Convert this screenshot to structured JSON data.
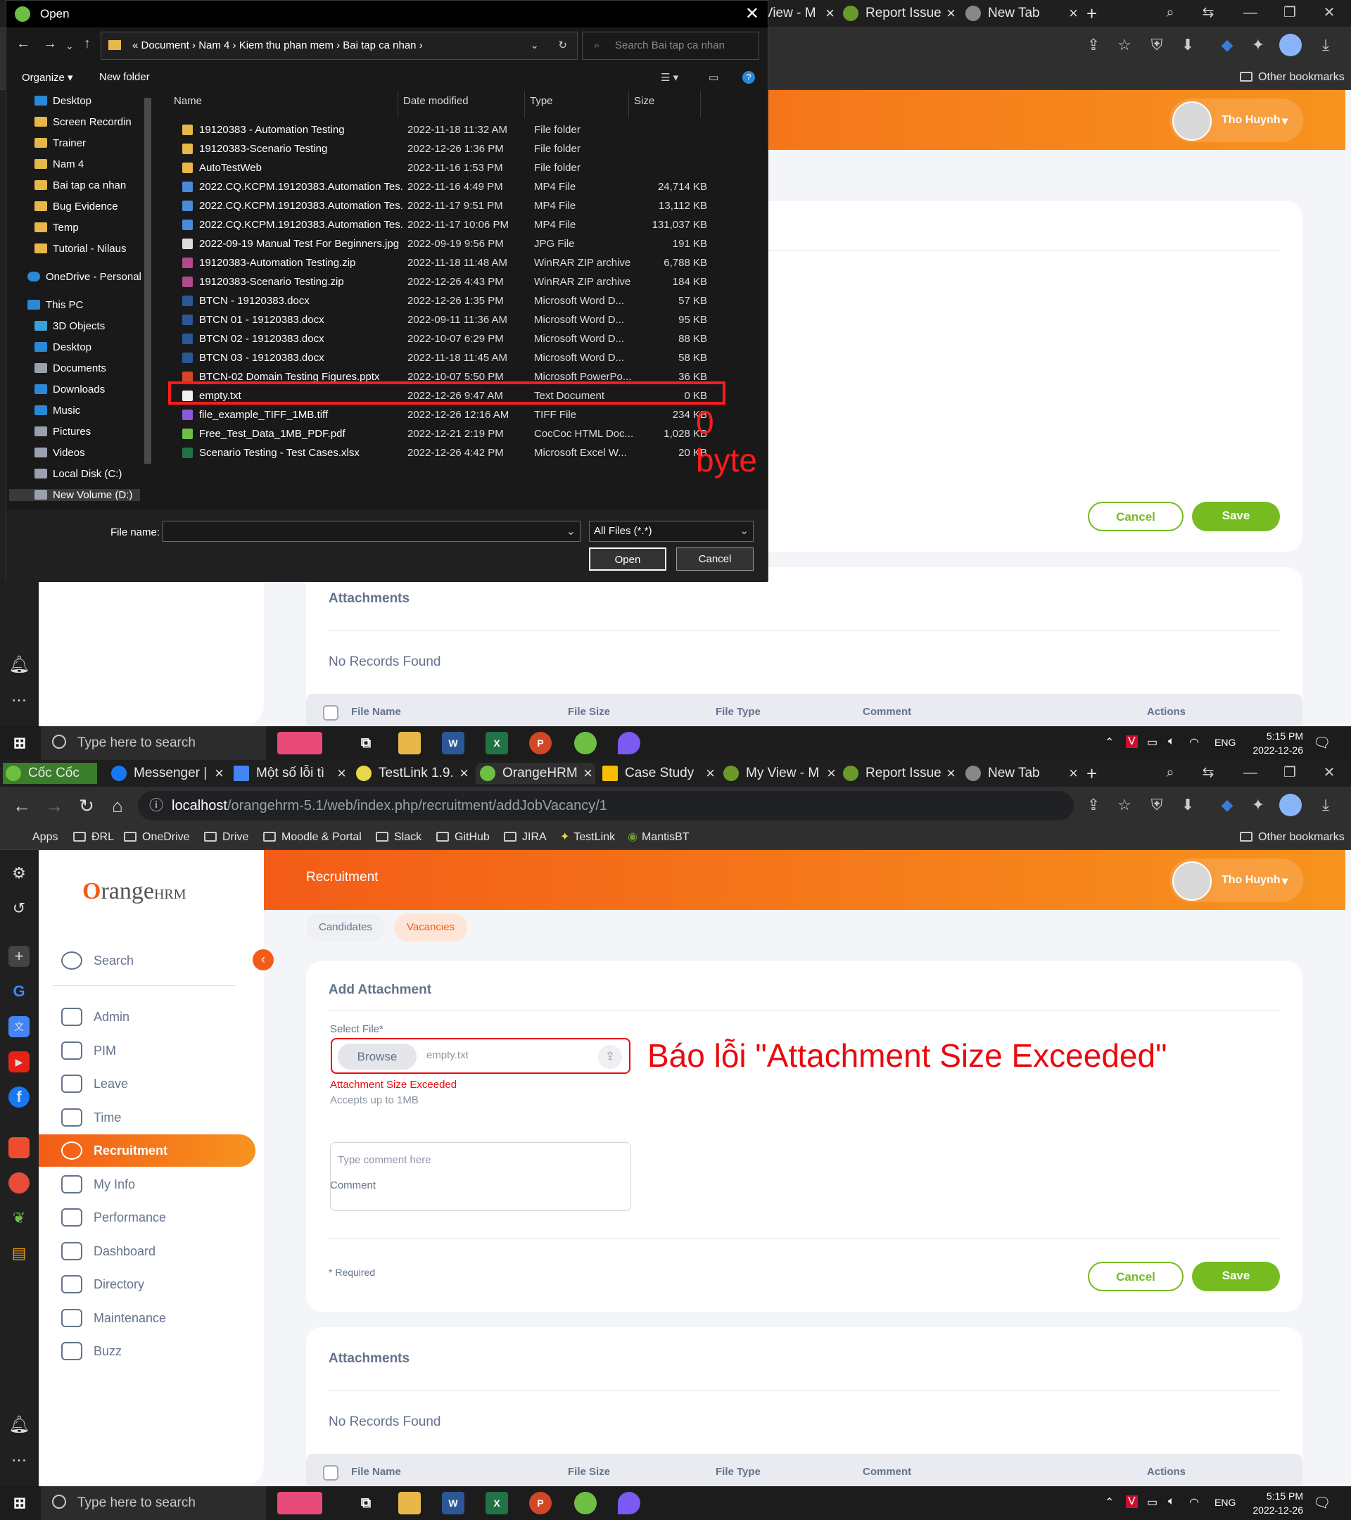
{
  "colors": {
    "orange": "#f35c17",
    "green": "#76bc21",
    "error": "#eb0910",
    "annotation_red": "#ff1b1b"
  },
  "browser": {
    "tabs": [
      {
        "label": "Cốc Cốc",
        "icon": "coccoc-icon"
      },
      {
        "label": "Messenger |",
        "icon": "facebook-icon"
      },
      {
        "label": "Một số lỗi tì",
        "icon": "docs-icon"
      },
      {
        "label": "TestLink 1.9.",
        "icon": "testlink-icon"
      },
      {
        "label": "OrangeHRM",
        "icon": "coccoc-icon"
      },
      {
        "label": "Case Study",
        "icon": "drive-icon"
      },
      {
        "label": "My View - M",
        "icon": "mantis-icon"
      },
      {
        "label": "Report Issue",
        "icon": "mantis-icon"
      },
      {
        "label": "New Tab",
        "icon": "coccoc-icon"
      }
    ],
    "top_tabs_visible": [
      {
        "label": "View - M"
      },
      {
        "label": "Report Issue"
      },
      {
        "label": "New Tab"
      }
    ],
    "url_host": "localhost",
    "url_path": "/orangehrm-5.1/web/index.php/recruitment/addJobVacancy/1",
    "bookmarks": [
      "Apps",
      "ĐRL",
      "OneDrive",
      "Drive",
      "Moodle & Portal",
      "Slack",
      "GitHub",
      "JIRA",
      "TestLink",
      "MantisBT"
    ],
    "other_bookmarks": "Other bookmarks"
  },
  "dialog": {
    "title": "Open",
    "breadcrumb": "«  Document  ›  Nam 4  ›  Kiem thu phan mem  ›  Bai tap ca nhan  ›",
    "search_placeholder": "Search Bai tap ca nhan",
    "organize": "Organize ▾",
    "new_folder": "New folder",
    "nav_tree": [
      {
        "label": "Desktop",
        "color": "#2b88d8"
      },
      {
        "label": "Screen Recordin",
        "color": "#e8b74a"
      },
      {
        "label": "Trainer",
        "color": "#e8b74a"
      },
      {
        "label": "Nam 4",
        "color": "#e8b74a"
      },
      {
        "label": "Bai tap ca nhan",
        "color": "#e8b74a"
      },
      {
        "label": "Bug Evidence",
        "color": "#e8b74a"
      },
      {
        "label": "Temp",
        "color": "#e8b74a"
      },
      {
        "label": "Tutorial - Nilaus",
        "color": "#e8b74a"
      },
      {
        "label": "OneDrive - Personal",
        "color": "#2b88d8"
      },
      {
        "label": "This PC",
        "color": "#2b88d8"
      },
      {
        "label": "3D Objects",
        "color": "#3aa0d8"
      },
      {
        "label": "Desktop",
        "color": "#2b88d8"
      },
      {
        "label": "Documents",
        "color": "#9aa0b0"
      },
      {
        "label": "Downloads",
        "color": "#2b88d8"
      },
      {
        "label": "Music",
        "color": "#2b88d8"
      },
      {
        "label": "Pictures",
        "color": "#9aa0b0"
      },
      {
        "label": "Videos",
        "color": "#9aa0b0"
      },
      {
        "label": "Local Disk (C:)",
        "color": "#9aa0b0"
      },
      {
        "label": "New Volume (D:)",
        "color": "#9aa0b0"
      }
    ],
    "columns": [
      "Name",
      "Date modified",
      "Type",
      "Size"
    ],
    "files": [
      {
        "name": "19120383 - Automation Testing",
        "date": "2022-11-18 11:32 AM",
        "type": "File folder",
        "size": "",
        "color": "#e8b74a"
      },
      {
        "name": "19120383-Scenario Testing",
        "date": "2022-12-26 1:36 PM",
        "type": "File folder",
        "size": "",
        "color": "#e8b74a"
      },
      {
        "name": "AutoTestWeb",
        "date": "2022-11-16 1:53 PM",
        "type": "File folder",
        "size": "",
        "color": "#e8b74a"
      },
      {
        "name": "2022.CQ.KCPM.19120383.Automation Tes...",
        "date": "2022-11-16 4:49 PM",
        "type": "MP4 File",
        "size": "24,714 KB",
        "color": "#4a8ad8"
      },
      {
        "name": "2022.CQ.KCPM.19120383.Automation Tes...",
        "date": "2022-11-17 9:51 PM",
        "type": "MP4 File",
        "size": "13,112 KB",
        "color": "#4a8ad8"
      },
      {
        "name": "2022.CQ.KCPM.19120383.Automation Tes...",
        "date": "2022-11-17 10:06 PM",
        "type": "MP4 File",
        "size": "131,037 KB",
        "color": "#4a8ad8"
      },
      {
        "name": "2022-09-19 Manual Test For Beginners.jpg",
        "date": "2022-09-19 9:56 PM",
        "type": "JPG File",
        "size": "191 KB",
        "color": "#dcdcdc"
      },
      {
        "name": "19120383-Automation Testing.zip",
        "date": "2022-11-18 11:48 AM",
        "type": "WinRAR ZIP archive",
        "size": "6,788 KB",
        "color": "#b04a8a"
      },
      {
        "name": "19120383-Scenario Testing.zip",
        "date": "2022-12-26 4:43 PM",
        "type": "WinRAR ZIP archive",
        "size": "184 KB",
        "color": "#b04a8a"
      },
      {
        "name": "BTCN - 19120383.docx",
        "date": "2022-12-26 1:35 PM",
        "type": "Microsoft Word D...",
        "size": "57 KB",
        "color": "#2b5797"
      },
      {
        "name": "BTCN 01 - 19120383.docx",
        "date": "2022-09-11 11:36 AM",
        "type": "Microsoft Word D...",
        "size": "95 KB",
        "color": "#2b5797"
      },
      {
        "name": "BTCN 02 - 19120383.docx",
        "date": "2022-10-07 6:29 PM",
        "type": "Microsoft Word D...",
        "size": "88 KB",
        "color": "#2b5797"
      },
      {
        "name": "BTCN 03 - 19120383.docx",
        "date": "2022-11-18 11:45 AM",
        "type": "Microsoft Word D...",
        "size": "58 KB",
        "color": "#2b5797"
      },
      {
        "name": "BTCN-02 Domain Testing Figures.pptx",
        "date": "2022-10-07 5:50 PM",
        "type": "Microsoft PowerPo...",
        "size": "36 KB",
        "color": "#d24726"
      },
      {
        "name": "empty.txt",
        "date": "2022-12-26 9:47 AM",
        "type": "Text Document",
        "size": "0 KB",
        "color": "#f0f0f0"
      },
      {
        "name": "file_example_TIFF_1MB.tiff",
        "date": "2022-12-26 12:16 AM",
        "type": "TIFF File",
        "size": "234 KB",
        "color": "#8a5ad8"
      },
      {
        "name": "Free_Test_Data_1MB_PDF.pdf",
        "date": "2022-12-21 2:19 PM",
        "type": "CocCoc HTML Doc...",
        "size": "1,028 KB",
        "color": "#6fbe44"
      },
      {
        "name": "Scenario Testing - Test Cases.xlsx",
        "date": "2022-12-26 4:42 PM",
        "type": "Microsoft Excel W...",
        "size": "20 KB",
        "color": "#217346"
      }
    ],
    "file_name_label": "File name:",
    "file_name_value": "",
    "file_type": "All Files (*.*)",
    "open_btn": "Open",
    "cancel_btn": "Cancel",
    "annotation": "0 byte"
  },
  "hrm": {
    "header_title": "Recruitment",
    "user_name": "Tho Huynh",
    "logo_prefix": "O",
    "logo_text": "range",
    "logo_suffix": "HRM",
    "menu": [
      {
        "label": "Search"
      },
      {
        "label": "Admin"
      },
      {
        "label": "PIM"
      },
      {
        "label": "Leave"
      },
      {
        "label": "Time"
      },
      {
        "label": "Recruitment",
        "active": true
      },
      {
        "label": "My Info"
      },
      {
        "label": "Performance"
      },
      {
        "label": "Dashboard"
      },
      {
        "label": "Directory"
      },
      {
        "label": "Maintenance"
      },
      {
        "label": "Buzz"
      }
    ],
    "chips": [
      "Candidates",
      "Vacancies"
    ],
    "form": {
      "title": "Add Attachment",
      "select_label": "Select File*",
      "browse": "Browse",
      "file_value": "empty.txt",
      "error": "Attachment Size Exceeded",
      "hint": "Accepts up to 1MB",
      "comment_label": "Comment",
      "comment_placeholder": "Type comment here",
      "required": "* Required",
      "cancel": "Cancel",
      "save": "Save"
    },
    "annotation": "Báo lỗi \"Attachment Size Exceeded\"",
    "attachments": {
      "title": "Attachments",
      "empty": "No Records Found",
      "columns": [
        "File Name",
        "File Size",
        "File Type",
        "Comment",
        "Actions"
      ]
    }
  },
  "taskbar": {
    "search": "Type here to search",
    "lang": "ENG",
    "time": "5:15 PM",
    "date": "2022-12-26"
  }
}
